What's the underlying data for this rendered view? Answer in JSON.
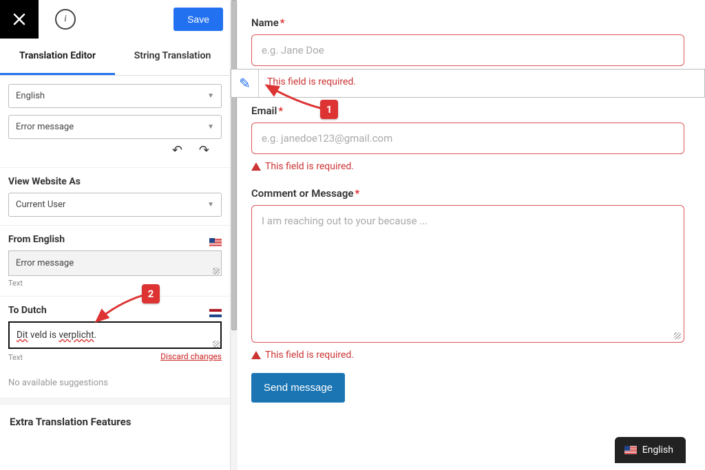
{
  "topbar": {
    "save": "Save"
  },
  "tabs": {
    "editor": "Translation Editor",
    "string": "String Translation"
  },
  "selectors": {
    "language": "English",
    "field": "Error message"
  },
  "view_as": {
    "title": "View Website As",
    "value": "Current User"
  },
  "from": {
    "title": "From English",
    "value": "Error message",
    "type": "Text"
  },
  "to": {
    "title": "To Dutch",
    "value_parts": {
      "a": "Dit",
      "b": " veld is ",
      "c": "verplicht",
      "d": "."
    },
    "type": "Text",
    "discard": "Discard changes"
  },
  "suggestions": "No available suggestions",
  "extra": "Extra Translation Features",
  "form": {
    "name": {
      "label": "Name",
      "placeholder": "e.g. Jane Doe"
    },
    "email": {
      "label": "Email",
      "placeholder": "e.g. janedoe123@gmail.com"
    },
    "message": {
      "label": "Comment or Message",
      "placeholder": "I am reaching out to your because ..."
    },
    "error": "This field is required.",
    "send": "Send message"
  },
  "hover_error": "This field is required.",
  "markers": {
    "one": "1",
    "two": "2"
  },
  "lang_switch": "English"
}
